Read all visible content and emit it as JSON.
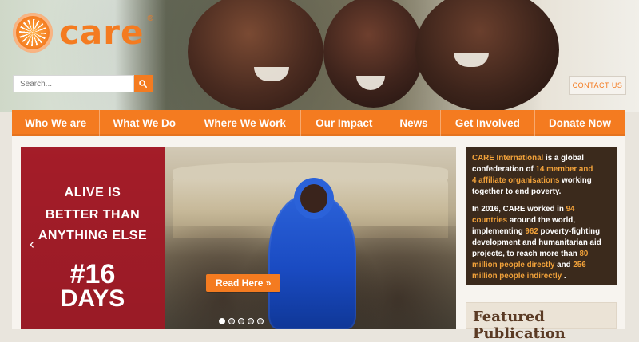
{
  "brand": {
    "name": "care",
    "registered": "®",
    "accent": "#f47b20",
    "logo_icon": "care-logo-icon"
  },
  "search": {
    "placeholder": "Search...",
    "icon": "search-icon"
  },
  "contact": {
    "label": "CONTACT US"
  },
  "nav": {
    "items": [
      "Who We are",
      "What We Do",
      "Where We Work",
      "Our Impact",
      "News",
      "Get Involved",
      "Donate Now"
    ]
  },
  "slider": {
    "title_lines": [
      "ALIVE IS",
      "BETTER THAN",
      "ANYTHING ELSE"
    ],
    "campaign_top": "#16",
    "campaign_bottom": "DAYS",
    "read_more": "Read Here »",
    "dots_total": 5,
    "dots_active": 1,
    "prev_icon": "chevron-left-icon"
  },
  "info": {
    "p1": {
      "prefix": "CARE International",
      "mid1": " is a global confederation of ",
      "highlight1": "14 member and",
      "highlight2": "4 affiliate organisations",
      "suffix": " working together to end poverty."
    },
    "p2": {
      "prefix": "In 2016, CARE worked in ",
      "highlight1": "94 countries",
      "mid1": " around the world, implementing ",
      "highlight2": "962",
      "mid2": " poverty-fighting development and humanitarian aid projects, to reach more than ",
      "highlight3": "80 million people directly",
      "mid3": " and ",
      "highlight4": "256 million people indirectly",
      "suffix": " ."
    }
  },
  "featured": {
    "title": "Featured Publication"
  }
}
